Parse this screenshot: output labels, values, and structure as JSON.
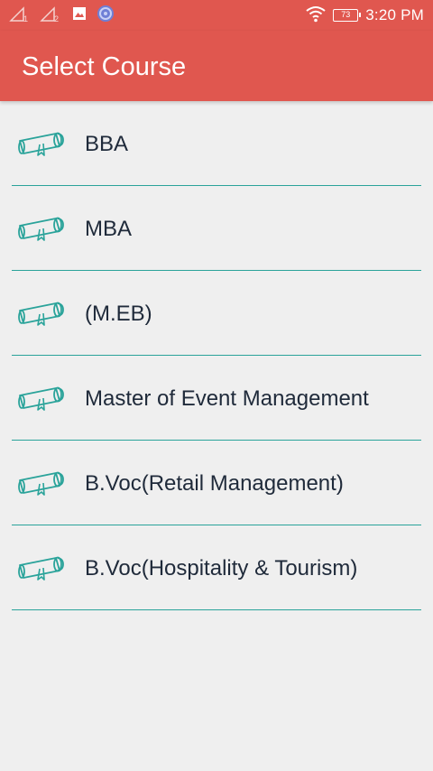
{
  "status_bar": {
    "sim1": "1",
    "sim2": "2",
    "battery": "73",
    "time": "3:20 PM"
  },
  "app_bar": {
    "title": "Select Course"
  },
  "courses": [
    {
      "label": "BBA"
    },
    {
      "label": "MBA"
    },
    {
      "label": "(M.EB)"
    },
    {
      "label": "Master of Event Management"
    },
    {
      "label": "B.Voc(Retail Management)"
    },
    {
      "label": "B.Voc(Hospitality & Tourism)"
    }
  ],
  "icons": {
    "course": "diploma-scroll-icon"
  },
  "colors": {
    "primary": "#e0574f",
    "accent": "#2aa39a",
    "background": "#efefef",
    "text": "#1f2a3a"
  }
}
